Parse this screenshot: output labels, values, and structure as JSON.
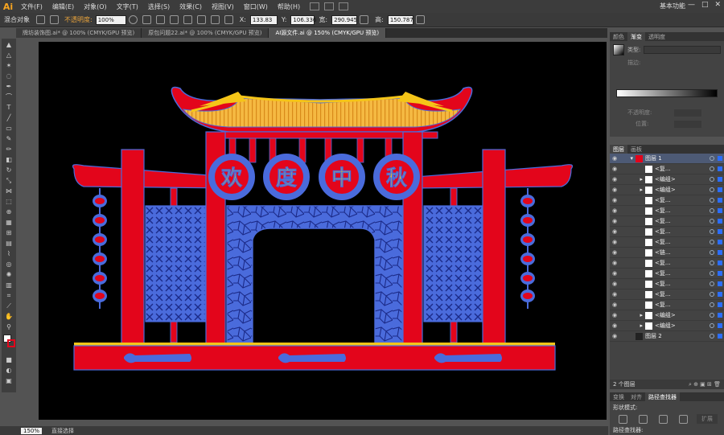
{
  "app": {
    "logo": "Ai",
    "workspace": "基本功能",
    "window_buttons": [
      "—",
      "□",
      "✕"
    ]
  },
  "menu": [
    "文件(F)",
    "编辑(E)",
    "对象(O)",
    "文字(T)",
    "选择(S)",
    "效果(C)",
    "视图(V)",
    "窗口(W)",
    "帮助(H)"
  ],
  "control_bar": {
    "mixed_objects": "混合对象",
    "opacity_label": "不透明度:",
    "opacity_value": "100%",
    "x_label": "X:",
    "x_value": "133.83",
    "y_label": "Y:",
    "y_value": "106.336",
    "w_label": "宽:",
    "w_value": "290.945",
    "h_label": "高:",
    "h_value": "150.787"
  },
  "doc_tabs": [
    {
      "label": "牌坊装饰图.ai* @ 100% (CMYK/GPU 预览)",
      "active": false
    },
    {
      "label": "原包问题22.ai* @ 100% (CMYK/GPU 预览)",
      "active": false
    },
    {
      "label": "AI源文件.ai @ 150% (CMYK/GPU 预览)",
      "active": true
    }
  ],
  "artwork_chars": [
    "欢",
    "度",
    "中",
    "秋"
  ],
  "gradient_panel": {
    "tabs": [
      "颜色",
      "渐变",
      "透明度"
    ],
    "type_label": "类型:",
    "stroke_label": "描边:",
    "opacity_label": "不透明度:",
    "position_label": "位置:"
  },
  "layers_panel": {
    "tabs": [
      "图层",
      "画板"
    ],
    "layers": [
      {
        "name": "图层 1",
        "level": 0,
        "expanded": true
      },
      {
        "name": "<复...",
        "level": 1
      },
      {
        "name": "<编组>",
        "level": 1,
        "arrow": true
      },
      {
        "name": "<编组>",
        "level": 1,
        "arrow": true
      },
      {
        "name": "<复...",
        "level": 1
      },
      {
        "name": "<复...",
        "level": 1
      },
      {
        "name": "<复...",
        "level": 1
      },
      {
        "name": "<复...",
        "level": 1
      },
      {
        "name": "<复...",
        "level": 1
      },
      {
        "name": "<链...",
        "level": 1
      },
      {
        "name": "<复...",
        "level": 1
      },
      {
        "name": "<复...",
        "level": 1
      },
      {
        "name": "<复...",
        "level": 1
      },
      {
        "name": "<复...",
        "level": 1
      },
      {
        "name": "<复...",
        "level": 1
      },
      {
        "name": "<编组>",
        "level": 1,
        "arrow": true
      },
      {
        "name": "<编组>",
        "level": 1,
        "arrow": true
      },
      {
        "name": "图层 2",
        "level": 0
      }
    ],
    "count_label": "2 个图层"
  },
  "bottom_panel": {
    "tabs": [
      "变换",
      "对齐",
      "路径查找器"
    ],
    "shape_mode_label": "形状模式:",
    "pathfinder_label": "路径查找器:",
    "expand_label": "扩展"
  },
  "status": {
    "zoom": "150%",
    "tool_label": "直接选择"
  },
  "colors": {
    "accent": "#2b6eff",
    "red": "#e3051b",
    "blue": "#4a6bdc",
    "gold": "#f5c518"
  }
}
